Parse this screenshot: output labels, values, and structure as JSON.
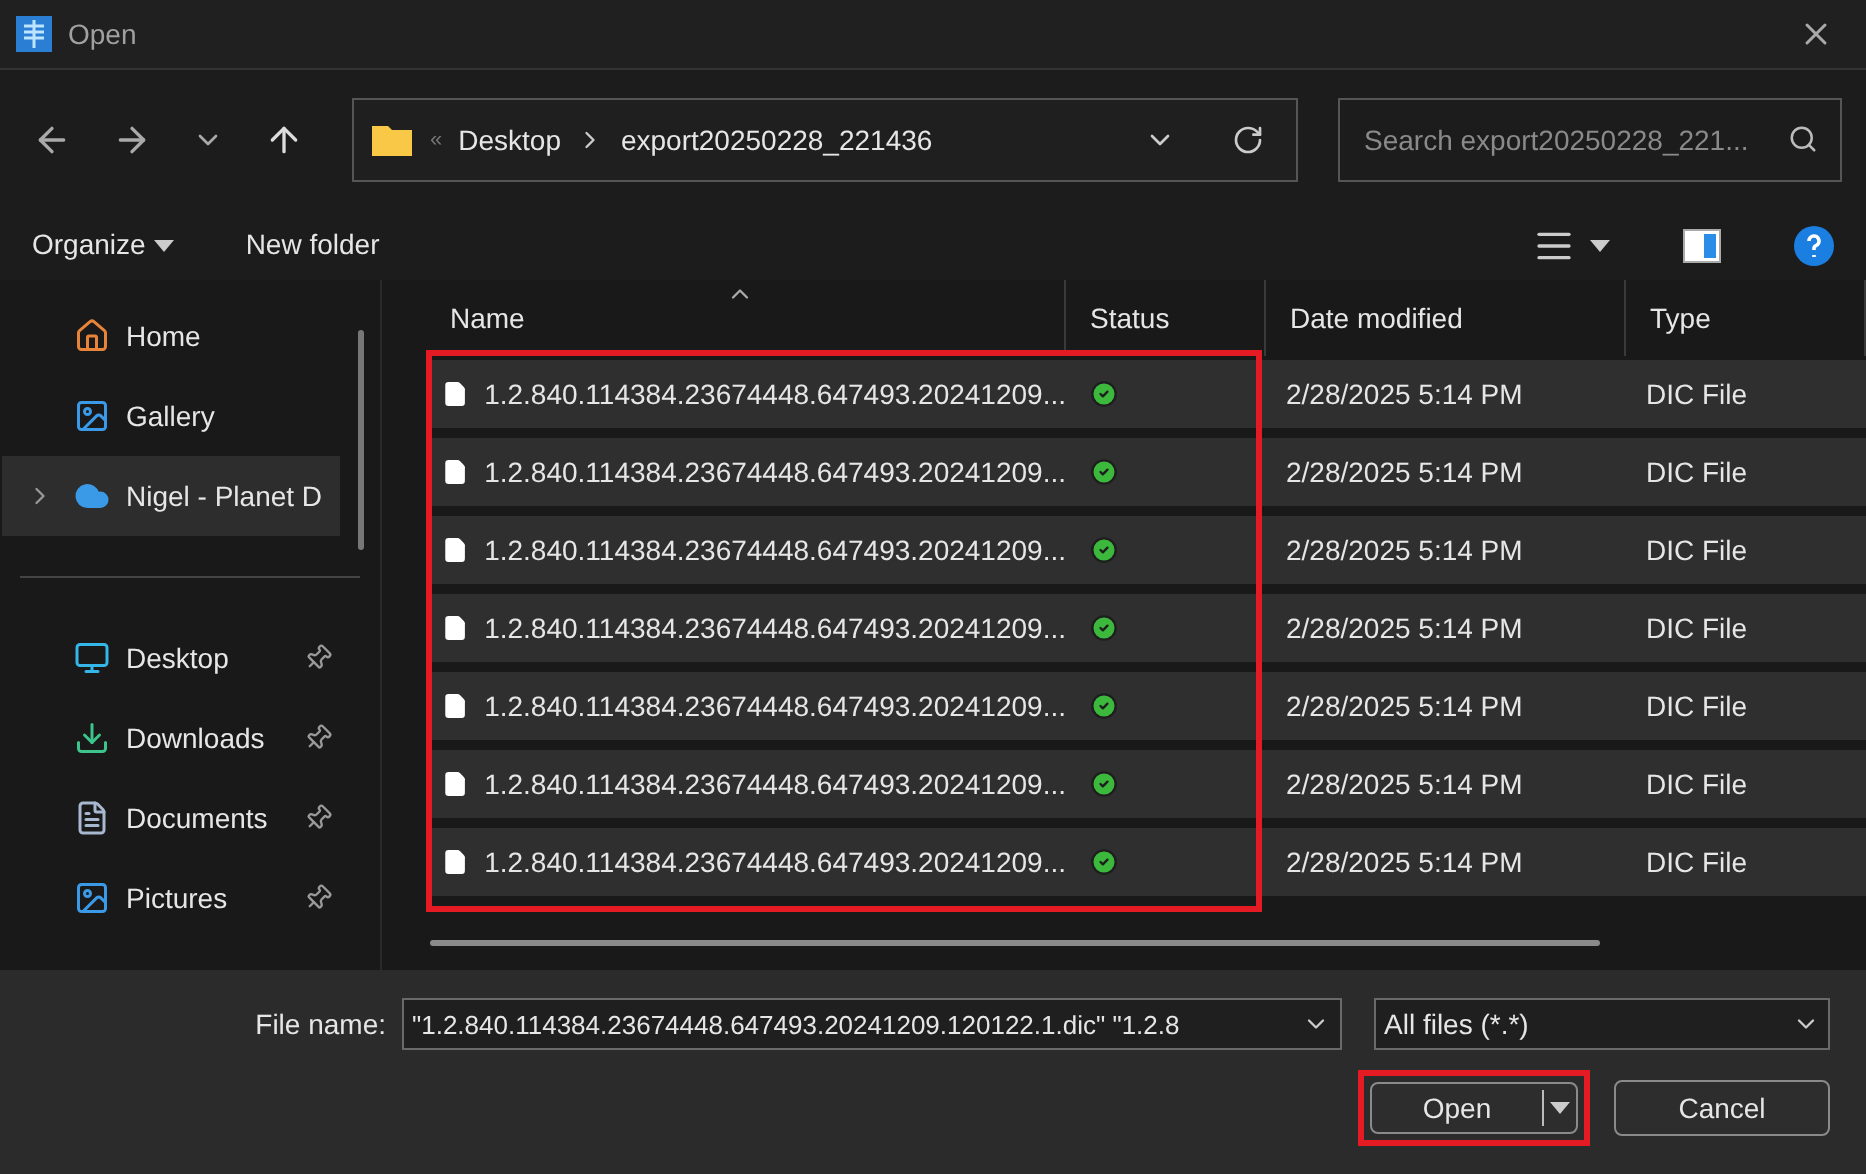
{
  "window": {
    "title": "Open"
  },
  "address": {
    "overflow": "«",
    "crumbs": [
      "Desktop",
      "export20250228_221436"
    ]
  },
  "search": {
    "placeholder": "Search export20250228_221..."
  },
  "commands": [
    "Organize",
    "New folder"
  ],
  "sidebar": {
    "items": [
      {
        "label": "Home",
        "kind": "home",
        "selected": false,
        "pinned": false
      },
      {
        "label": "Gallery",
        "kind": "gallery",
        "selected": false,
        "pinned": false
      },
      {
        "label": "Nigel - Planet D",
        "kind": "cloud",
        "selected": true,
        "pinned": false
      },
      {
        "label": "Desktop",
        "kind": "desktop",
        "selected": false,
        "pinned": true
      },
      {
        "label": "Downloads",
        "kind": "downloads",
        "selected": false,
        "pinned": true
      },
      {
        "label": "Documents",
        "kind": "documents",
        "selected": false,
        "pinned": true
      },
      {
        "label": "Pictures",
        "kind": "pictures",
        "selected": false,
        "pinned": true
      }
    ]
  },
  "table": {
    "columns": [
      "Name",
      "Status",
      "Date modified",
      "Type"
    ],
    "rows": [
      {
        "name": "1.2.840.114384.23674448.647493.20241209...",
        "date": "2/28/2025 5:14 PM",
        "type": "DIC File",
        "selected": true
      },
      {
        "name": "1.2.840.114384.23674448.647493.20241209...",
        "date": "2/28/2025 5:14 PM",
        "type": "DIC File",
        "selected": true
      },
      {
        "name": "1.2.840.114384.23674448.647493.20241209...",
        "date": "2/28/2025 5:14 PM",
        "type": "DIC File",
        "selected": true
      },
      {
        "name": "1.2.840.114384.23674448.647493.20241209...",
        "date": "2/28/2025 5:14 PM",
        "type": "DIC File",
        "selected": true
      },
      {
        "name": "1.2.840.114384.23674448.647493.20241209...",
        "date": "2/28/2025 5:14 PM",
        "type": "DIC File",
        "selected": true
      },
      {
        "name": "1.2.840.114384.23674448.647493.20241209...",
        "date": "2/28/2025 5:14 PM",
        "type": "DIC File",
        "selected": true
      },
      {
        "name": "1.2.840.114384.23674448.647493.20241209...",
        "date": "2/28/2025 5:14 PM",
        "type": "DIC File",
        "selected": true
      }
    ]
  },
  "footer": {
    "file_name_label": "File name:",
    "file_name_value": "\"1.2.840.114384.23674448.647493.20241209.120122.1.dic\" \"1.2.8",
    "filter": "All files (*.*)",
    "buttons": [
      "Open",
      "Cancel"
    ]
  }
}
